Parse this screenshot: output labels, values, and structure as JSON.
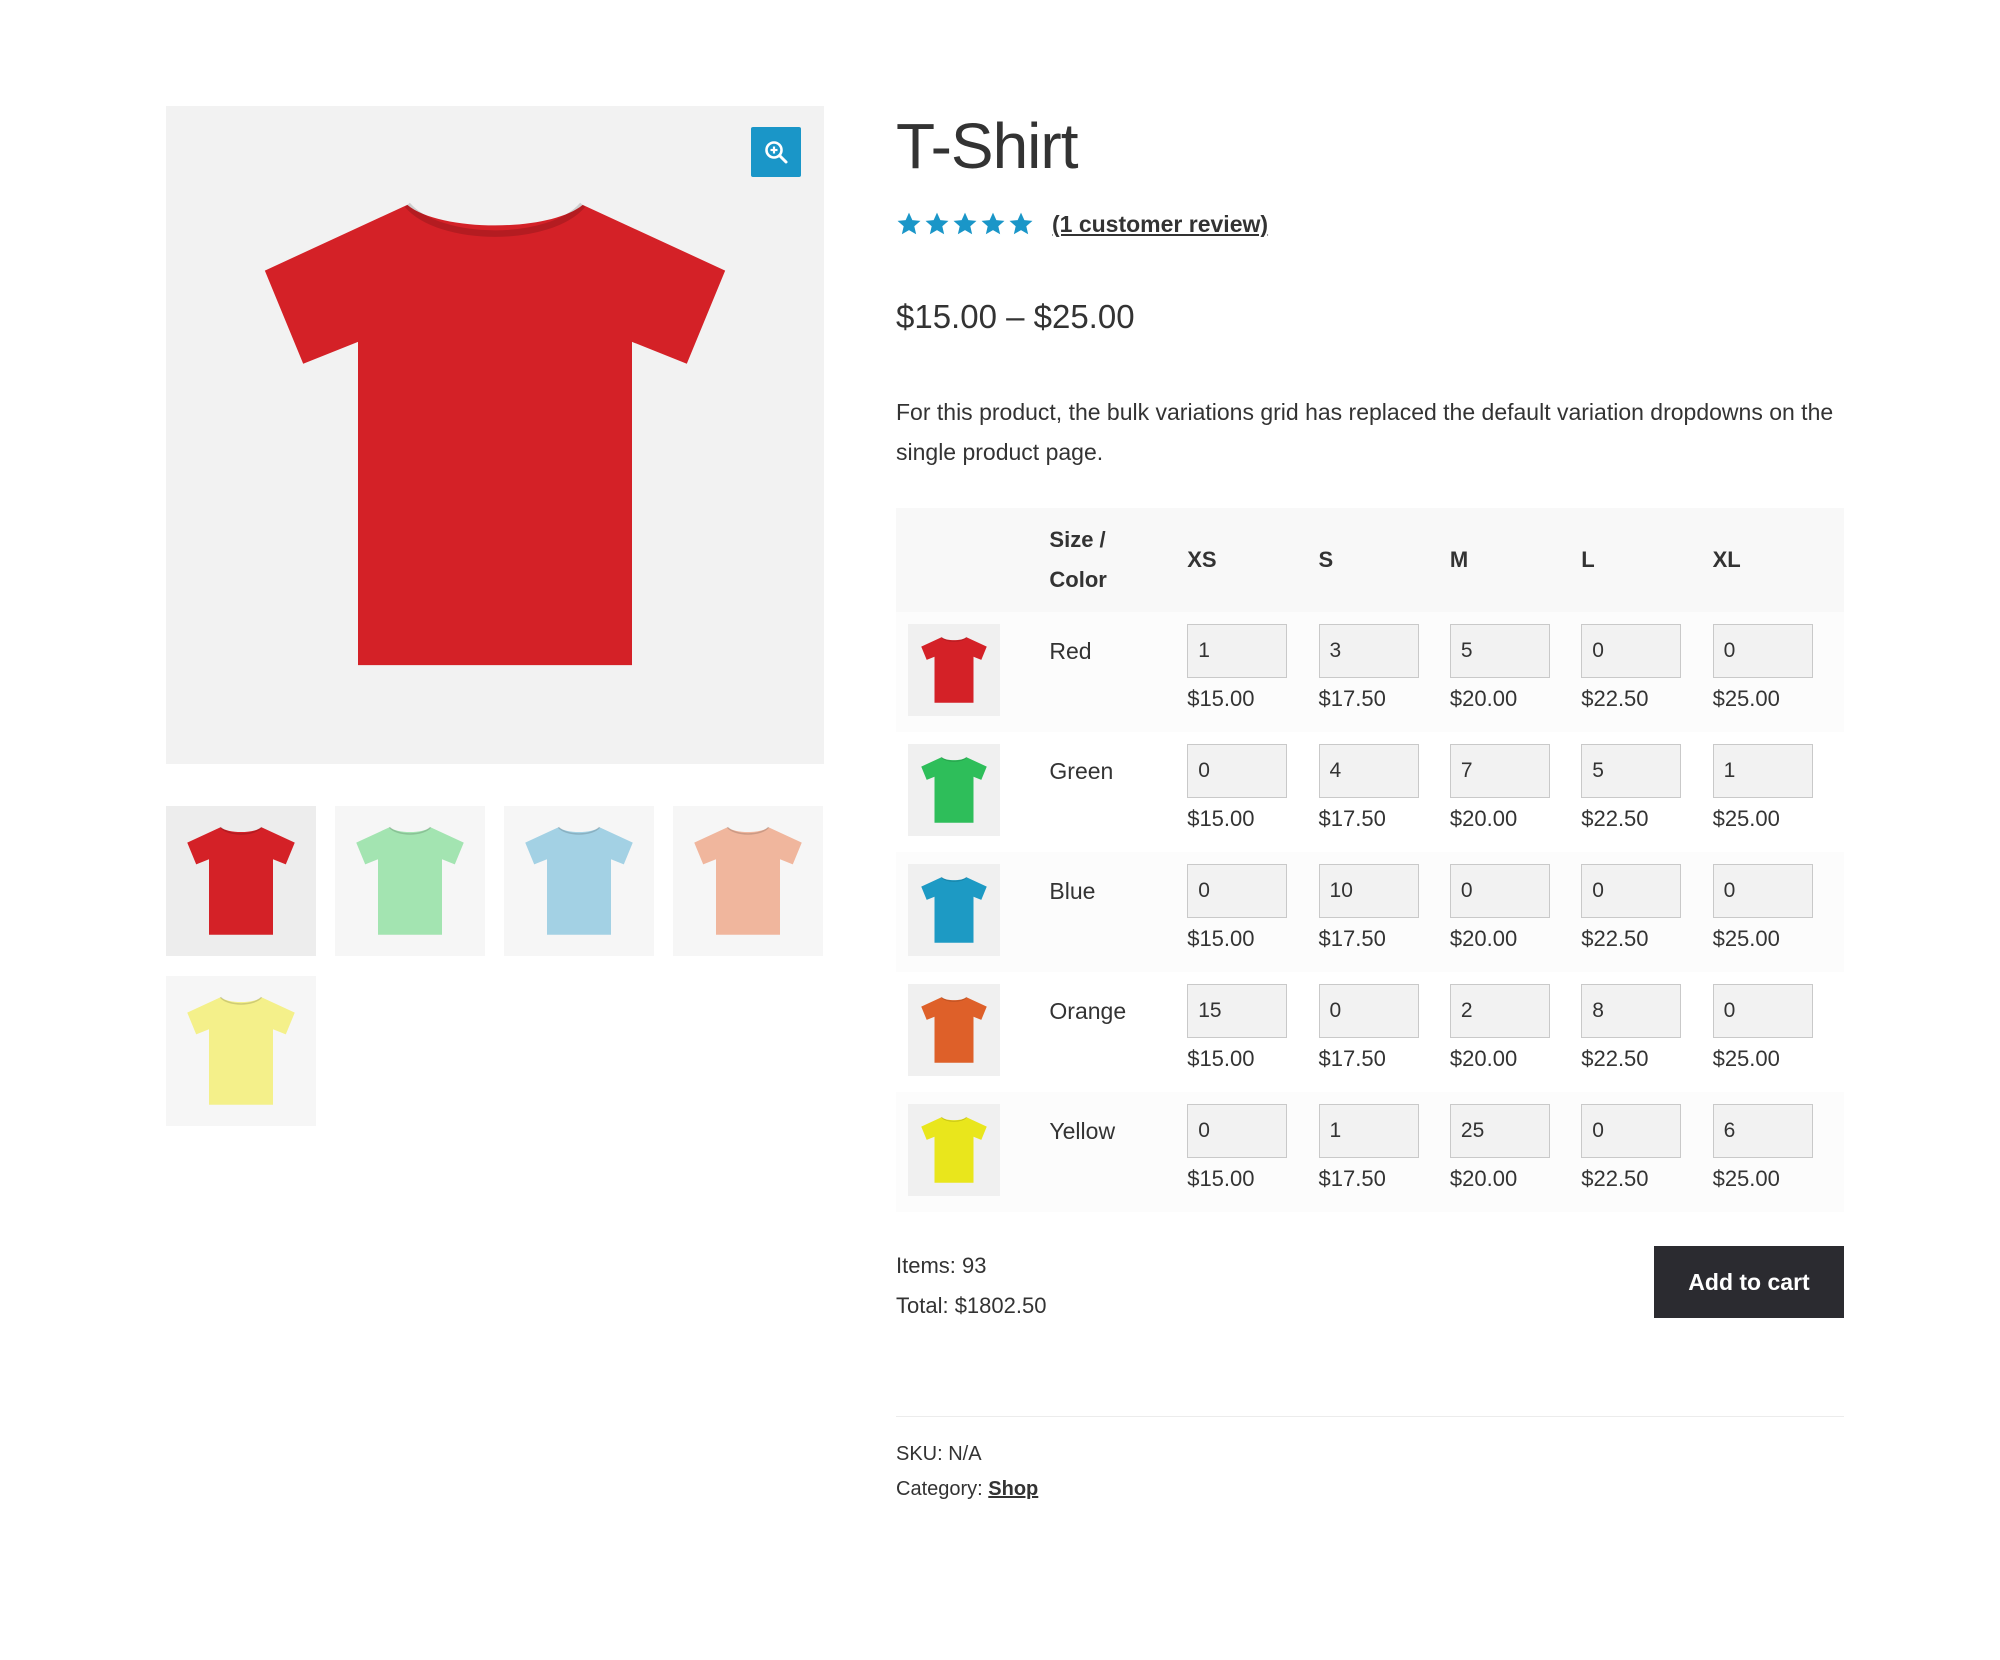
{
  "product": {
    "title": "T-Shirt",
    "rating": 5,
    "review_link": "(1 customer review)",
    "price_range": "$15.00 – $25.00",
    "description": "For this product, the bulk variations grid has replaced the default variation dropdowns on the single product page."
  },
  "gallery": {
    "main_color": "#d42127",
    "thumbnails": [
      {
        "color": "#d42127",
        "active": true
      },
      {
        "color": "#a3e4b1",
        "active": false
      },
      {
        "color": "#a3d1e4",
        "active": false
      },
      {
        "color": "#f0b69d",
        "active": false
      },
      {
        "color": "#f4f08a",
        "active": false
      }
    ]
  },
  "grid": {
    "header_label": [
      "Size /",
      "Color"
    ],
    "sizes": [
      "XS",
      "S",
      "M",
      "L",
      "XL"
    ],
    "rows": [
      {
        "color": "Red",
        "swatch": "#d42127",
        "qty": [
          "1",
          "3",
          "5",
          "0",
          "0"
        ],
        "prices": [
          "$15.00",
          "$17.50",
          "$20.00",
          "$22.50",
          "$25.00"
        ]
      },
      {
        "color": "Green",
        "swatch": "#2ebe5a",
        "qty": [
          "0",
          "4",
          "7",
          "5",
          "1"
        ],
        "prices": [
          "$15.00",
          "$17.50",
          "$20.00",
          "$22.50",
          "$25.00"
        ]
      },
      {
        "color": "Blue",
        "swatch": "#1d9ac4",
        "qty": [
          "0",
          "10",
          "0",
          "0",
          "0"
        ],
        "prices": [
          "$15.00",
          "$17.50",
          "$20.00",
          "$22.50",
          "$25.00"
        ]
      },
      {
        "color": "Orange",
        "swatch": "#de6029",
        "qty": [
          "15",
          "0",
          "2",
          "8",
          "0"
        ],
        "prices": [
          "$15.00",
          "$17.50",
          "$20.00",
          "$22.50",
          "$25.00"
        ]
      },
      {
        "color": "Yellow",
        "swatch": "#e9e61c",
        "qty": [
          "0",
          "1",
          "25",
          "0",
          "6"
        ],
        "prices": [
          "$15.00",
          "$17.50",
          "$20.00",
          "$22.50",
          "$25.00"
        ]
      }
    ]
  },
  "summary": {
    "items": "Items: 93",
    "total": "Total: $1802.50",
    "add_to_cart": "Add to cart"
  },
  "meta": {
    "sku": "SKU: N/A",
    "category_label": "Category:",
    "category_link": "Shop"
  },
  "colors": {
    "accent": "#1a96c8",
    "star": "#1a96c8",
    "button": "#2b2b30"
  },
  "icons": {
    "zoom": "zoom-in-icon",
    "star": "star-icon"
  }
}
